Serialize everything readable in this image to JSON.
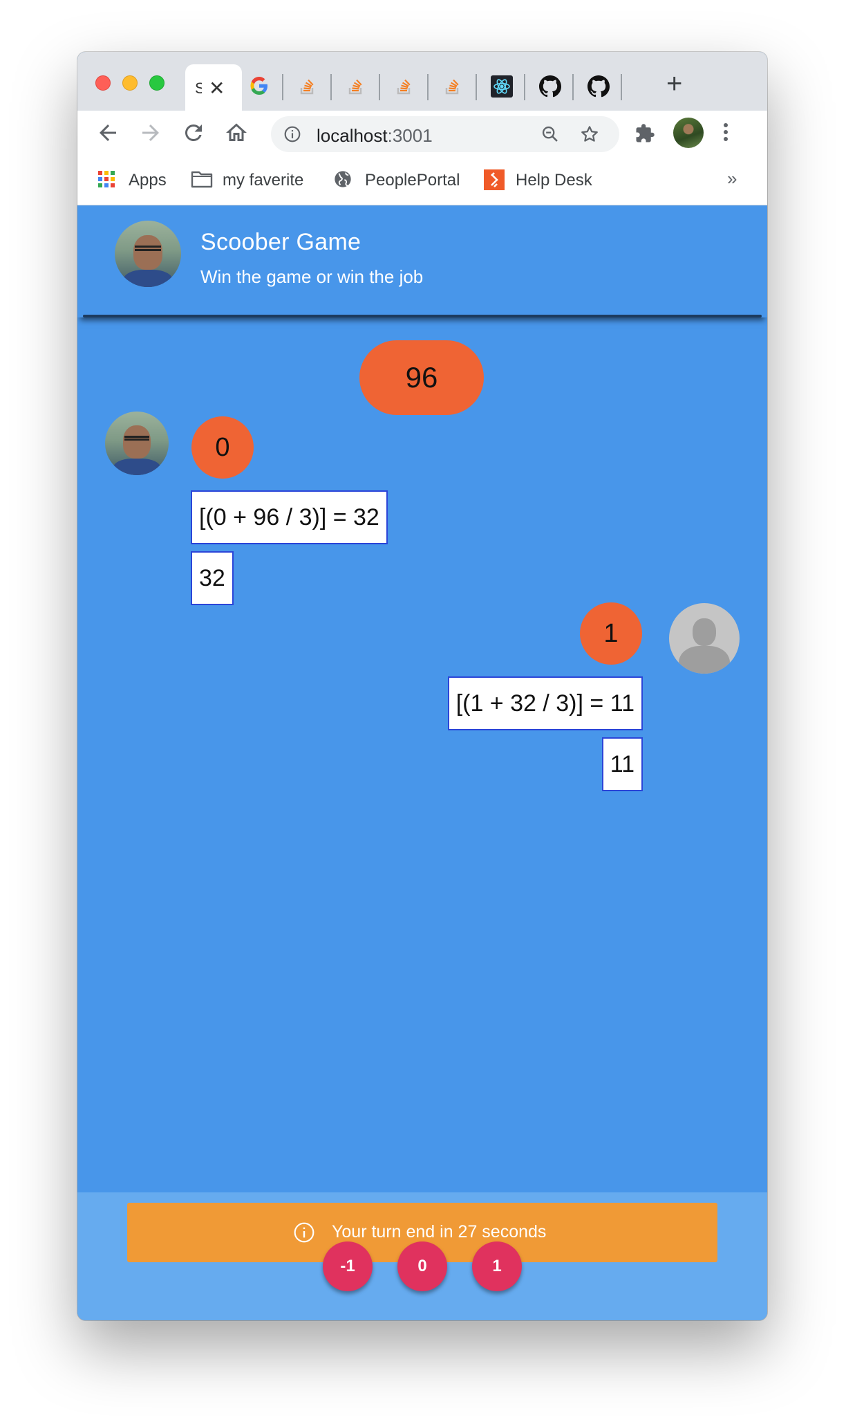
{
  "browser": {
    "tabs": {
      "active_title": "S",
      "icons": [
        "google-icon",
        "stackoverflow-icon",
        "stackoverflow-icon",
        "stackoverflow-icon",
        "stackoverflow-icon",
        "react-icon",
        "github-icon",
        "github-icon"
      ]
    },
    "url": {
      "host": "localhost",
      "port": ":3001"
    },
    "bookmarks": [
      {
        "label": "Apps",
        "icon": "apps-grid-icon"
      },
      {
        "label": "my faverite",
        "icon": "folder-icon"
      },
      {
        "label": "PeoplePortal",
        "icon": "globe-icon"
      },
      {
        "label": "Help Desk",
        "icon": "helpdesk-icon"
      }
    ],
    "bookmarks_more": "»"
  },
  "app": {
    "header": {
      "title": "Scoober Game",
      "subtitle": "Win the game or win the job"
    },
    "start_number": "96",
    "moves": [
      {
        "player": "me",
        "added": "0",
        "equation": "[(0 + 96 / 3)] = 32",
        "result": "32"
      },
      {
        "player": "opponent",
        "added": "1",
        "equation": "[(1 + 32 / 3)] = 11",
        "result": "11"
      }
    ],
    "turn_message": "Your turn end in 27 seconds",
    "buttons": [
      "-1",
      "0",
      "1"
    ]
  },
  "colors": {
    "page_bg": "#4896ea",
    "footer_bg": "#66abef",
    "bubble": "#ef6434",
    "banner": "#f09a36",
    "move_button": "#e0325e"
  }
}
